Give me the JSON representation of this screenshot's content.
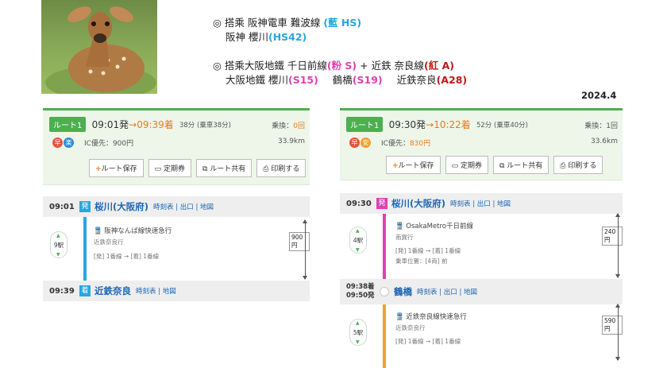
{
  "notes": {
    "line1_prefix": "◎ 搭乘 阪神電車 難波線",
    "line1_tag": "(藍 HS)",
    "line2_prefix": "阪神 櫻川",
    "line2_tag": "(HS42)",
    "line3_prefix": "◎ 搭乘大阪地鐵 千日前線",
    "line3_tag": "(粉 S)",
    "line3_plus": "+ 近鉄 奈良線",
    "line3_tag2": "(紅 A)",
    "line4_a": "大阪地鐵 櫻川",
    "line4_a_tag": "(S15)",
    "line4_b": "鶴橋",
    "line4_b_tag": "(S19)",
    "line4_c": "近鉄奈良",
    "line4_c_tag": "(A28)"
  },
  "year": "2024.4",
  "colors": {
    "accent": "#4caf50",
    "orange": "#e87b1c",
    "blue_line": "#29a6e0",
    "pink_line": "#e040b0",
    "amber_line": "#f0a030"
  },
  "buttons": {
    "save": "ルート保存",
    "pass": "定期券",
    "share": "ルート共有",
    "print": "印刷する"
  },
  "route_left": {
    "tag": "ルート1",
    "depart": "09:01発",
    "arrive": "→09:39着",
    "duration": "38分 (乗車38分)",
    "transfer_label": "乗換：",
    "transfer_count": "0回",
    "fare": "IC優先：900円",
    "distance": "33.9km",
    "badges": [
      "早",
      "楽"
    ],
    "start": {
      "time": "09:01",
      "mark": "発",
      "name": "桜川(大阪府)",
      "links": "時刻表 | 出口 | 地図"
    },
    "segment": {
      "line": "阪神なんば線快速急行",
      "dest": "近鉄奈良行",
      "platform": "[発] 1番線 → [着] 1番線",
      "stops": "9駅",
      "fare": "900円"
    },
    "end": {
      "time": "09:39",
      "mark": "着",
      "name": "近鉄奈良",
      "links": "時刻表 | 地図"
    }
  },
  "route_right": {
    "tag": "ルート1",
    "depart": "09:30発",
    "arrive": "→10:22着",
    "duration": "52分 (乗車40分)",
    "transfer_label": "乗換：",
    "transfer_count": "1回",
    "fare_label": "IC優先：",
    "fare": "830円",
    "distance": "33.6km",
    "badges": [
      "早",
      "安"
    ],
    "start": {
      "time": "09:30",
      "mark": "発",
      "name": "桜川(大阪府)",
      "links": "時刻表 | 出口 | 地図"
    },
    "segment1": {
      "line": "OsakaMetro千日前線",
      "dest": "南巽行",
      "platform": "[発] 1番線 → [着] 1番線",
      "pos": "乗車位置：[4両] 前",
      "stops": "4駅",
      "fare": "240円"
    },
    "mid": {
      "time_arr": "09:38着",
      "time_dep": "09:50発",
      "name": "鶴橋",
      "links": "時刻表 | 出口 | 地図"
    },
    "segment2": {
      "line": "近鉄奈良線快速急行",
      "dest": "近鉄奈良行",
      "platform": "[発] 1番線 → [着] 1番線",
      "stops": "5駅",
      "fare": "590円"
    }
  }
}
